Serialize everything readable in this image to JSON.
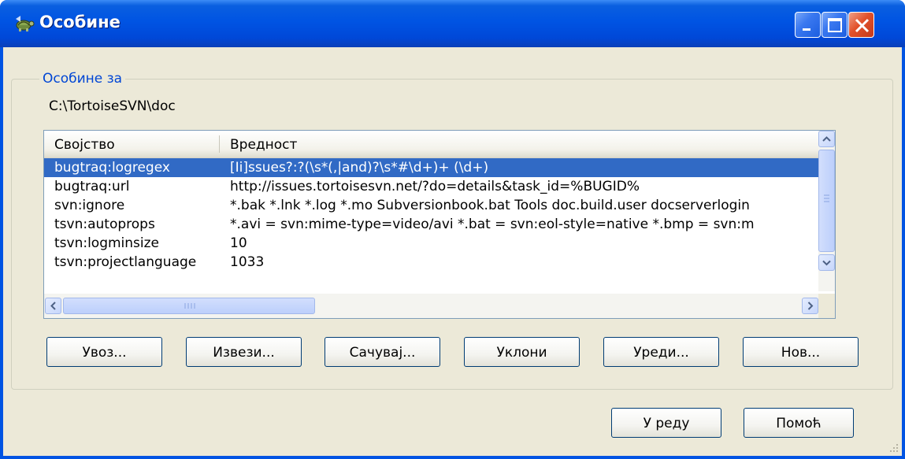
{
  "window": {
    "title": "Особине",
    "title_icon": "tortoise-icon"
  },
  "group": {
    "legend": "Особине за",
    "path": "C:\\TortoiseSVN\\doc"
  },
  "list": {
    "columns": [
      "Својство",
      "Вредност"
    ],
    "rows": [
      {
        "name": "bugtraq:logregex",
        "value": "[Ii]ssues?:?(\\s*(,|and)?\\s*#\\d+)+ (\\d+)",
        "selected": true
      },
      {
        "name": "bugtraq:url",
        "value": "http://issues.tortoisesvn.net/?do=details&task_id=%BUGID%",
        "selected": false
      },
      {
        "name": "svn:ignore",
        "value": "*.bak *.lnk *.log *.mo Subversionbook.bat Tools doc.build.user docserverlogin",
        "selected": false
      },
      {
        "name": "tsvn:autoprops",
        "value": "*.avi = svn:mime-type=video/avi *.bat = svn:eol-style=native *.bmp = svn:m",
        "selected": false
      },
      {
        "name": "tsvn:logminsize",
        "value": "10",
        "selected": false
      },
      {
        "name": "tsvn:projectlanguage",
        "value": "1033",
        "selected": false
      }
    ]
  },
  "buttons": {
    "import": "Увоз...",
    "export": "Извези...",
    "save": "Сачувај...",
    "remove": "Уклони",
    "edit": "Уреди...",
    "new": "Нов...",
    "ok": "У реду",
    "help": "Помоћ"
  },
  "colors": {
    "titlebar": "#0054e3",
    "selection": "#316ac5",
    "dialog_bg": "#ece9d8",
    "legend_text": "#0046d5"
  }
}
